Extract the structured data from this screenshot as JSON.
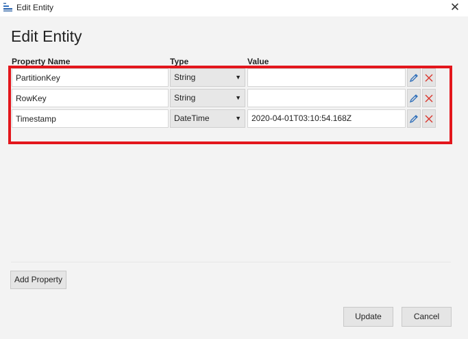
{
  "window": {
    "title": "Edit Entity",
    "close_glyph": "✕",
    "app_icon": "table-icon"
  },
  "heading": "Edit Entity",
  "columns": {
    "property_name": "Property Name",
    "type": "Type",
    "value": "Value"
  },
  "rows": [
    {
      "name": "PartitionKey",
      "type": "String",
      "value": ""
    },
    {
      "name": "RowKey",
      "type": "String",
      "value": ""
    },
    {
      "name": "Timestamp",
      "type": "DateTime",
      "value": "2020-04-01T03:10:54.168Z"
    }
  ],
  "icons": {
    "dropdown": "chevron-down-icon",
    "edit": "pencil-icon",
    "delete": "close-icon"
  },
  "buttons": {
    "add_property": "Add Property",
    "update": "Update",
    "cancel": "Cancel"
  },
  "colors": {
    "highlight": "#e3161c",
    "edit_icon": "#2b6cb8",
    "delete_icon": "#d9342b"
  }
}
